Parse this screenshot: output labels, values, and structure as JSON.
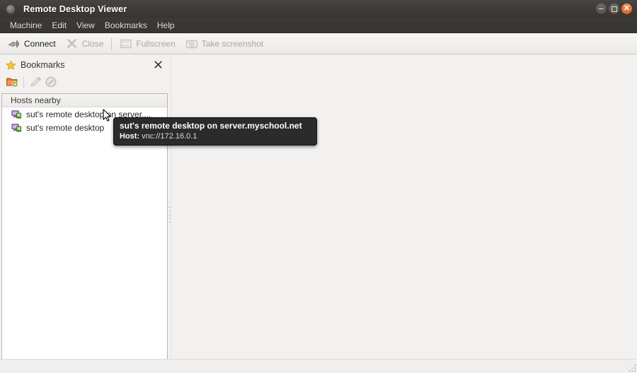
{
  "window": {
    "title": "Remote Desktop Viewer",
    "app_icon": "app-circle-icon",
    "controls": {
      "minimize": "minimize-icon",
      "maximize": "maximize-icon",
      "close": "close-icon"
    }
  },
  "menubar": {
    "items": [
      {
        "label": "Machine"
      },
      {
        "label": "Edit"
      },
      {
        "label": "View"
      },
      {
        "label": "Bookmarks"
      },
      {
        "label": "Help"
      }
    ]
  },
  "toolbar": {
    "buttons": [
      {
        "label": "Connect",
        "icon": "plug-connect-icon",
        "enabled": true
      },
      {
        "label": "Close",
        "icon": "x-close-icon",
        "enabled": false
      },
      {
        "label": "Fullscreen",
        "icon": "fullscreen-icon",
        "enabled": false
      },
      {
        "label": "Take screenshot",
        "icon": "camera-icon",
        "enabled": false
      }
    ]
  },
  "sidebar": {
    "title": "Bookmarks",
    "star_icon": "star-icon",
    "close_icon": "panel-close-icon",
    "actions": [
      {
        "name": "new-folder",
        "icon": "folder-add-icon",
        "enabled": true
      },
      {
        "name": "edit",
        "icon": "pencil-edit-icon",
        "enabled": false
      },
      {
        "name": "delete",
        "icon": "prohibited-delete-icon",
        "enabled": false
      }
    ],
    "groups": [
      {
        "header": "Hosts nearby",
        "items": [
          {
            "label": "sut's remote desktop on server....",
            "icon": "remote-desktop-icon"
          },
          {
            "label": "sut's remote desktop",
            "icon": "remote-desktop-icon"
          }
        ]
      }
    ]
  },
  "tooltip": {
    "title": "sut's remote desktop on server.myschool.net",
    "host_key": "Host:",
    "host_value": "vnc://172.16.0.1"
  },
  "colors": {
    "titlebar": "#3e3c38",
    "close_button": "#e06c30",
    "tooltip_bg": "#2b2b2b",
    "panel_bg": "#f2f1f0",
    "list_bg": "#ffffff"
  }
}
